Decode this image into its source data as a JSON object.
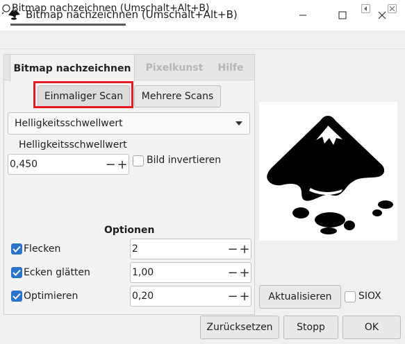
{
  "window": {
    "title": "Bitmap nachzeichnen (Umschalt+Alt+B)"
  },
  "dock": {
    "title": "Bitmap nachzeichnen (Umschalt+Alt+B)"
  },
  "tabs": [
    {
      "label": "Bitmap nachzeichnen",
      "active": true
    },
    {
      "label": "Pixelkunst",
      "active": false
    },
    {
      "label": "Hilfe",
      "active": false
    }
  ],
  "scan": {
    "single_label": "Einmaliger Scan",
    "multi_label": "Mehrere Scans"
  },
  "mode_select": {
    "value": "Helligkeitsschwellwert"
  },
  "threshold": {
    "label": "Helligkeitsschwellwert",
    "value": "0,450",
    "invert_label": "Bild invertieren",
    "invert_checked": false
  },
  "options": {
    "title": "Optionen",
    "items": [
      {
        "label": "Flecken",
        "value": "2",
        "checked": true
      },
      {
        "label": "Ecken glätten",
        "value": "1,00",
        "checked": true
      },
      {
        "label": "Optimieren",
        "value": "0,20",
        "checked": true
      }
    ]
  },
  "preview": {
    "refresh_label": "Aktualisieren",
    "siox_label": "SIOX",
    "siox_checked": false
  },
  "buttons": {
    "reset": "Zurücksetzen",
    "stop": "Stopp",
    "ok": "OK"
  },
  "spin": {
    "minus": "−",
    "plus": "+"
  },
  "colors": {
    "highlight": "#e21b23",
    "checkbox": "#2b72c9"
  }
}
